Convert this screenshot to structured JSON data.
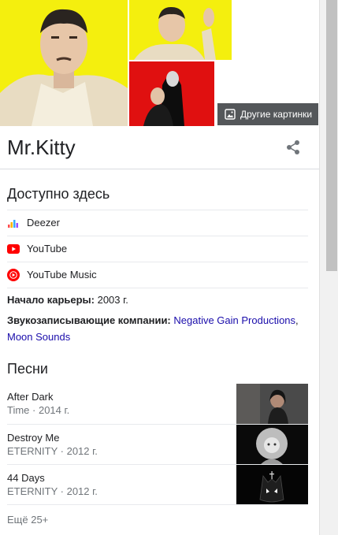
{
  "images": {
    "photo_1": "artist-photo-yellow",
    "photo_2": "artist-photo-yellow-wave",
    "photo_3": "artist-photo-red-duo",
    "more_images_label": "Другие картинки"
  },
  "header": {
    "title": "Mr.Kitty",
    "share_icon": "share-icon"
  },
  "available": {
    "heading": "Доступно здесь",
    "items": [
      {
        "label": "Deezer",
        "icon": "deezer-icon"
      },
      {
        "label": "YouTube",
        "icon": "youtube-icon"
      },
      {
        "label": "YouTube Music",
        "icon": "youtube-music-icon"
      }
    ]
  },
  "facts": {
    "career_label": "Начало карьеры:",
    "career_value": " 2003 г.",
    "labels_label": "Звукозаписывающие компании:",
    "label_1": "Negative Gain Productions",
    "separator": ",",
    "label_2": "Moon Sounds"
  },
  "songs": {
    "heading": "Песни",
    "items": [
      {
        "title": "After Dark",
        "meta": "Time · 2014 г."
      },
      {
        "title": "Destroy Me",
        "meta": "ETERNITY · 2012 г."
      },
      {
        "title": "44 Days",
        "meta": "ETERNITY · 2012 г."
      }
    ],
    "more": "Ещё 25+"
  },
  "colors": {
    "accent_link": "#1a0dab",
    "photo_bg_yellow": "#f4ef0e",
    "photo_bg_red": "#e01010",
    "youtube_red": "#ff0000"
  }
}
